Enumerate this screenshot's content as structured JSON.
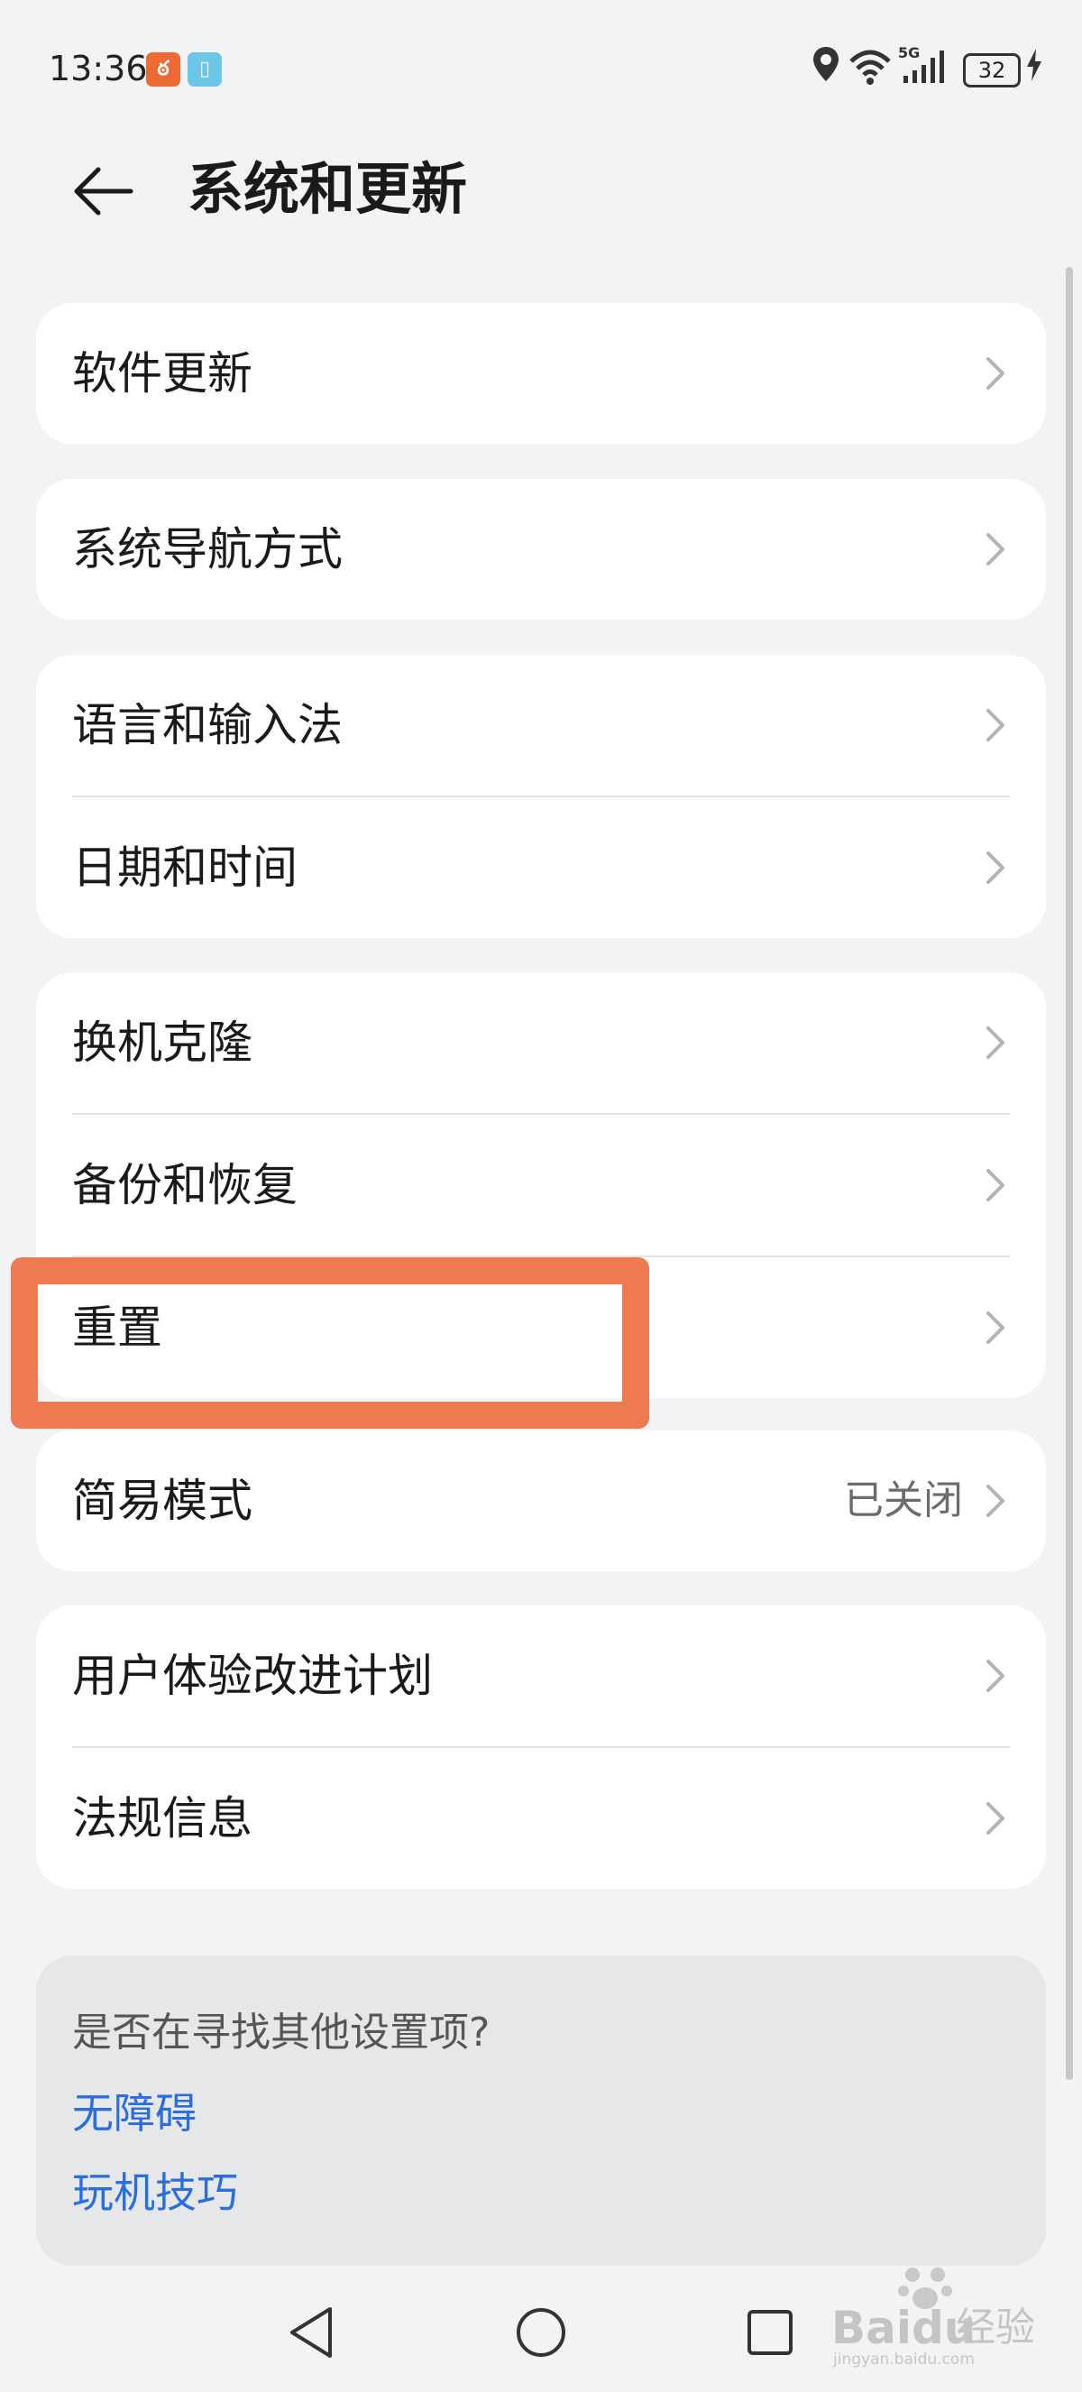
{
  "status_bar": {
    "time": "13:36",
    "battery": "32",
    "network": "5G"
  },
  "header": {
    "title": "系统和更新"
  },
  "cards": [
    {
      "items": [
        {
          "label": "软件更新"
        }
      ]
    },
    {
      "items": [
        {
          "label": "系统导航方式"
        }
      ]
    },
    {
      "items": [
        {
          "label": "语言和输入法"
        },
        {
          "label": "日期和时间"
        }
      ]
    },
    {
      "items": [
        {
          "label": "换机克隆"
        },
        {
          "label": "备份和恢复"
        },
        {
          "label": "重置"
        }
      ]
    },
    {
      "items": [
        {
          "label": "简易模式",
          "value": "已关闭"
        }
      ]
    },
    {
      "items": [
        {
          "label": "用户体验改进计划"
        },
        {
          "label": "法规信息"
        }
      ]
    }
  ],
  "suggestions": {
    "title": "是否在寻找其他设置项?",
    "links": [
      "无障碍",
      "玩机技巧"
    ]
  },
  "watermark": {
    "brand": "Baidu",
    "product": "经验",
    "site": "jingyan.baidu.com"
  },
  "colors": {
    "highlight": "#ee7a52",
    "link": "#2a6de0",
    "background": "#f1f3f5"
  }
}
